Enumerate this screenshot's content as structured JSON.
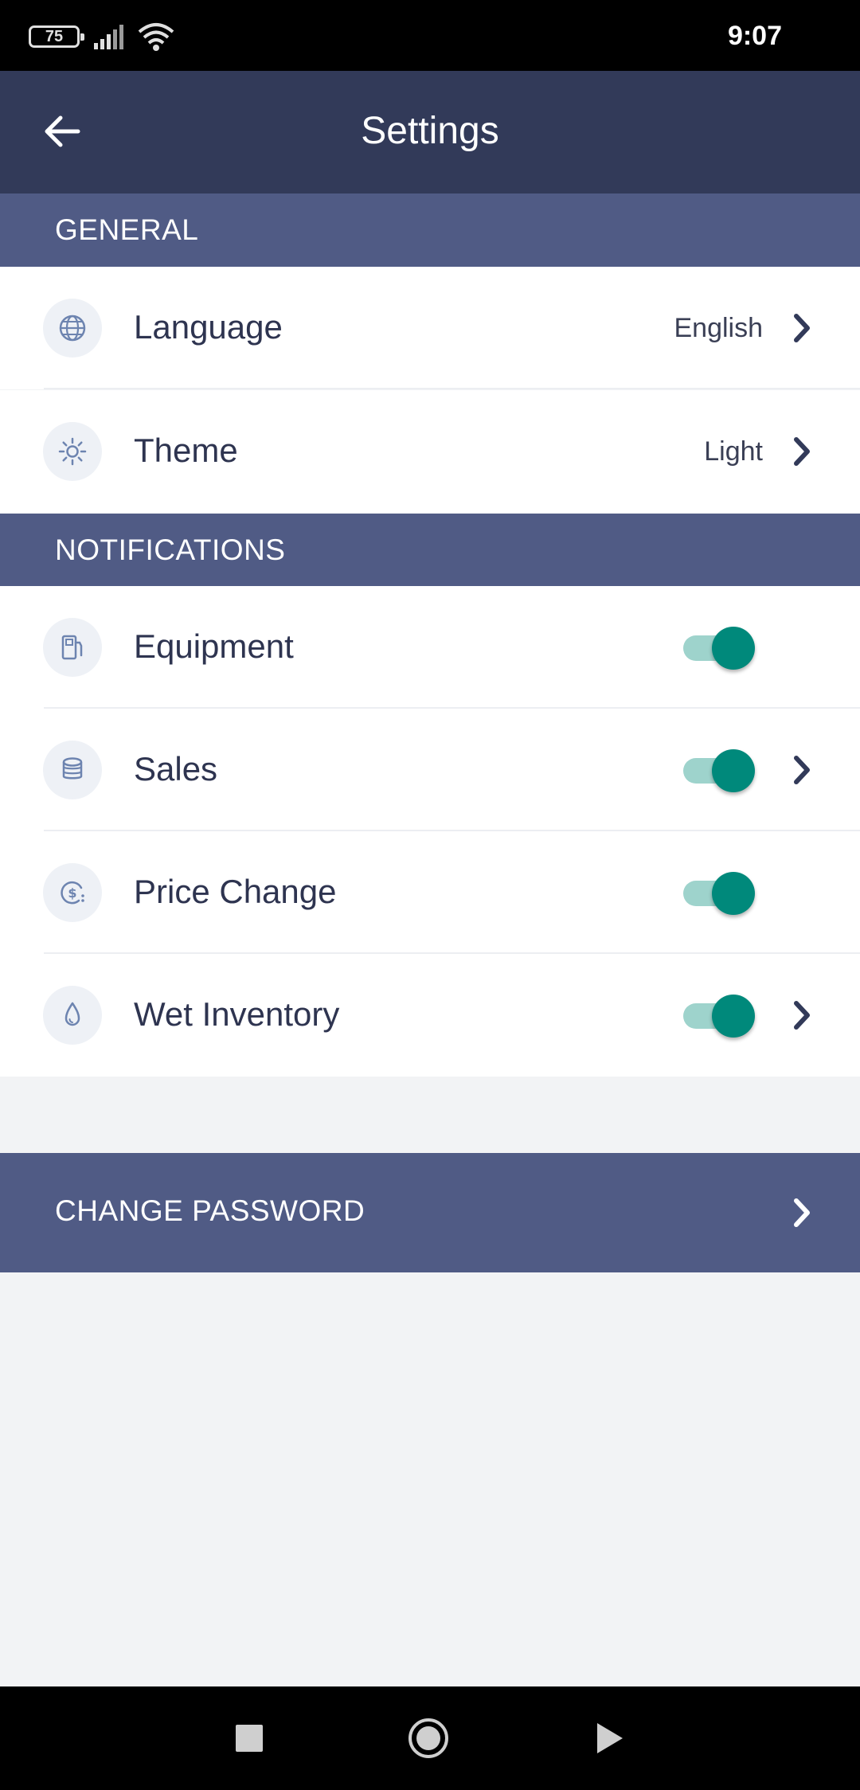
{
  "status_bar": {
    "battery": "75",
    "time": "9:07"
  },
  "app_bar": {
    "title": "Settings"
  },
  "general": {
    "header": "GENERAL",
    "items": [
      {
        "label": "Language",
        "value": "English",
        "icon": "globe-icon"
      },
      {
        "label": "Theme",
        "value": "Light",
        "icon": "sun-icon"
      }
    ]
  },
  "notifications": {
    "header": "NOTIFICATIONS",
    "items": [
      {
        "label": "Equipment",
        "enabled": true,
        "icon": "fuel-pump-icon"
      },
      {
        "label": "Sales",
        "enabled": true,
        "icon": "coins-icon"
      },
      {
        "label": "Price Change",
        "enabled": true,
        "icon": "dollar-coin-icon"
      },
      {
        "label": "Wet Inventory",
        "enabled": true,
        "icon": "droplet-icon"
      }
    ]
  },
  "change_password": {
    "label": "CHANGE PASSWORD"
  },
  "colors": {
    "app_bar": "#323a59",
    "section_header": "#505b85",
    "toggle_on": "#00897b",
    "toggle_track": "#9ed3cc",
    "background": "#f2f3f5"
  }
}
